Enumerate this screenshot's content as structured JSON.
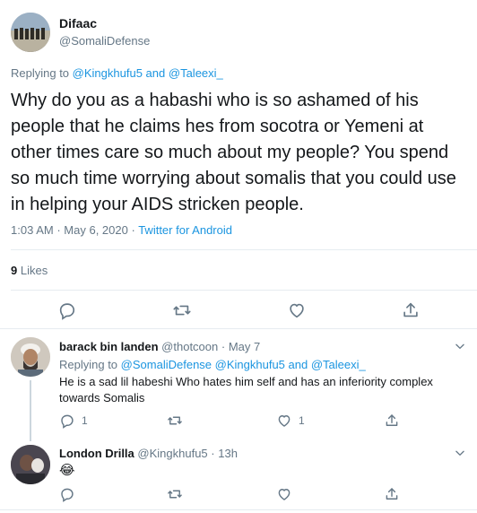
{
  "main_tweet": {
    "author_name": "Difaac",
    "author_handle": "@SomaliDefense",
    "replying_to_label": "Replying to",
    "replying_to_1": "@Kingkhufu5",
    "replying_to_and": "and",
    "replying_to_2": "@Taleexi_",
    "text": "Why do you as a habashi who is so ashamed of his people that he claims hes from socotra or Yemeni at other times care so much about my people? You spend so much time worrying about somalis that you could use in helping your AIDS stricken people.",
    "time": "1:03 AM",
    "date": "May 6, 2020",
    "source": "Twitter for Android",
    "likes_count": "9",
    "likes_label": "Likes",
    "meta_sep": "·"
  },
  "reply1": {
    "author_name": "barack bin landen",
    "author_handle": "@thotcoon",
    "sep": "·",
    "date": "May 7",
    "replying_to_label": "Replying to",
    "mention1": "@SomaliDefense",
    "mention2": "@Kingkhufu5",
    "and": "and",
    "mention3": "@Taleexi_",
    "text": "He is a sad lil habeshi Who hates him self and has an inferiority complex towards Somalis",
    "reply_count": "1",
    "like_count": "1"
  },
  "reply2": {
    "author_name": "London Drilla",
    "author_handle": "@Kingkhufu5",
    "sep": "·",
    "date": "13h",
    "text": "😂"
  },
  "icons": {
    "reply": "reply-icon",
    "retweet": "retweet-icon",
    "like": "heart-icon",
    "share": "share-icon",
    "more": "chevron-down-icon"
  },
  "colors": {
    "link": "#1b95e0",
    "muted": "#657786",
    "border": "#e6ecf0",
    "thread_line": "#ccd6dd"
  }
}
